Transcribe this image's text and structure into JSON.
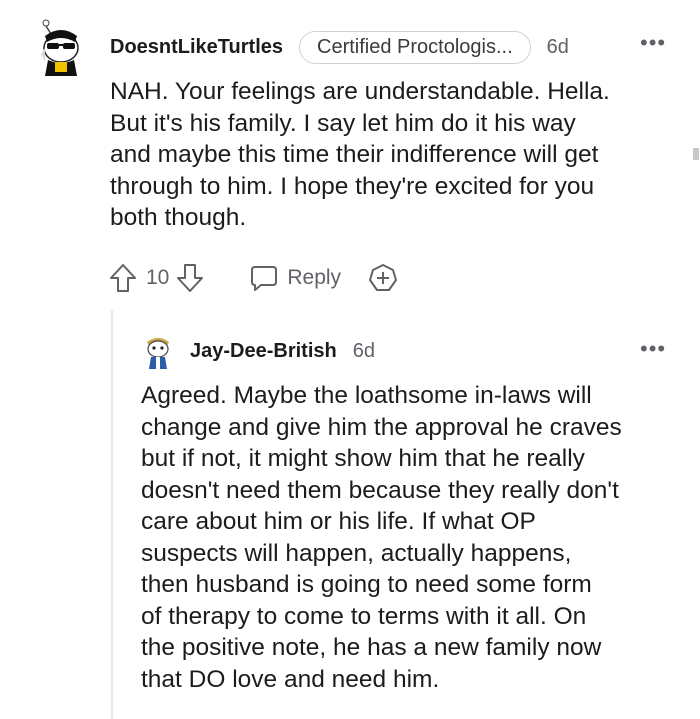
{
  "comment": {
    "username": "DoesntLikeTurtles",
    "flair": "Certified Proctologis...",
    "age": "6d",
    "more": "•••",
    "body": "NAH. Your feelings are understandable. Hella.\nBut it's his family. I say let him do it his way\nand maybe this time their indifference will get\nthrough to him. I hope they're excited for you\nboth though.",
    "vote_count": "10",
    "reply_label": "Reply",
    "icons": [
      "upvote-icon",
      "downvote-icon",
      "reply-bubble-icon",
      "add-award-icon",
      "more-options-icon"
    ]
  },
  "reply": {
    "username": "Jay-Dee-British",
    "age": "6d",
    "more": "•••",
    "body": "Agreed. Maybe the loathsome in-laws will\nchange and give him the approval he craves\nbut if not, it might show him that he really\ndoesn't need them because they really don't\ncare about him or his life. If what OP\nsuspects will happen, actually happens,\nthen husband is going to need some form\nof therapy to come to terms with it all. On\nthe positive note, he has a new family now\nthat DO love and need him."
  },
  "colors": {
    "text": "#1c1c1c",
    "muted": "#5f6368",
    "flair_border": "#cfd2d4",
    "thread_line": "#e9e9e9"
  }
}
